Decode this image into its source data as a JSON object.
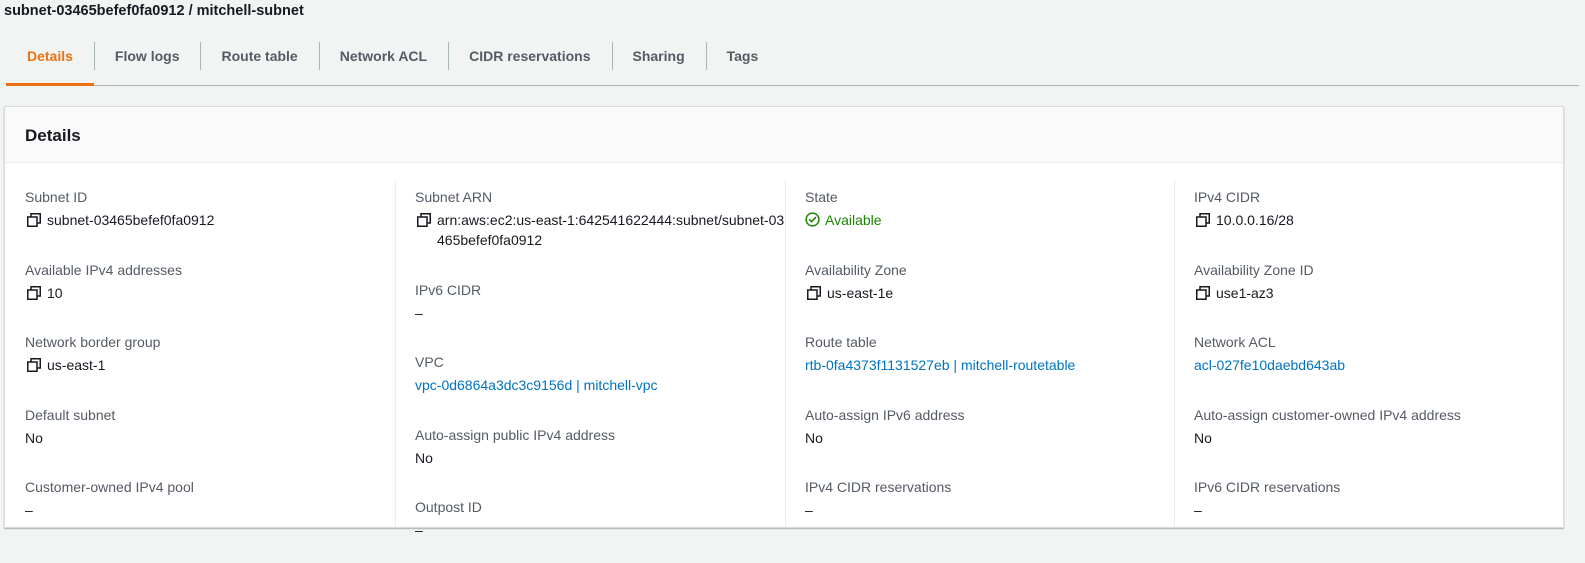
{
  "page": {
    "title": "subnet-03465befef0fa0912 / mitchell-subnet"
  },
  "tabs": [
    {
      "label": "Details",
      "active": true
    },
    {
      "label": "Flow logs",
      "active": false
    },
    {
      "label": "Route table",
      "active": false
    },
    {
      "label": "Network ACL",
      "active": false
    },
    {
      "label": "CIDR reservations",
      "active": false
    },
    {
      "label": "Sharing",
      "active": false
    },
    {
      "label": "Tags",
      "active": false
    }
  ],
  "details": {
    "heading": "Details",
    "col1": {
      "subnet_id": {
        "label": "Subnet ID",
        "value": "subnet-03465befef0fa0912"
      },
      "available_ipv4": {
        "label": "Available IPv4 addresses",
        "value": "10"
      },
      "network_border_group": {
        "label": "Network border group",
        "value": "us-east-1"
      },
      "default_subnet": {
        "label": "Default subnet",
        "value": "No"
      },
      "customer_owned_pool": {
        "label": "Customer-owned IPv4 pool",
        "value": "–"
      }
    },
    "col2": {
      "subnet_arn": {
        "label": "Subnet ARN",
        "value": "arn:aws:ec2:us-east-1:642541622444:subnet/subnet-03465befef0fa0912"
      },
      "ipv6_cidr": {
        "label": "IPv6 CIDR",
        "value": "–"
      },
      "vpc": {
        "label": "VPC",
        "value": "vpc-0d6864a3dc3c9156d | mitchell-vpc"
      },
      "auto_assign_public_ipv4": {
        "label": "Auto-assign public IPv4 address",
        "value": "No"
      },
      "outpost_id": {
        "label": "Outpost ID",
        "value": "–"
      }
    },
    "col3": {
      "state": {
        "label": "State",
        "value": "Available"
      },
      "availability_zone": {
        "label": "Availability Zone",
        "value": "us-east-1e"
      },
      "route_table": {
        "label": "Route table",
        "value": "rtb-0fa4373f1131527eb | mitchell-routetable"
      },
      "auto_assign_ipv6": {
        "label": "Auto-assign IPv6 address",
        "value": "No"
      },
      "ipv4_cidr_reservations": {
        "label": "IPv4 CIDR reservations",
        "value": "–"
      }
    },
    "col4": {
      "ipv4_cidr": {
        "label": "IPv4 CIDR",
        "value": "10.0.0.16/28"
      },
      "availability_zone_id": {
        "label": "Availability Zone ID",
        "value": "use1-az3"
      },
      "network_acl": {
        "label": "Network ACL",
        "value": "acl-027fe10daebd643ab"
      },
      "auto_assign_customer_ipv4": {
        "label": "Auto-assign customer-owned IPv4 address",
        "value": "No"
      },
      "ipv6_cidr_reservations": {
        "label": "IPv6 CIDR reservations",
        "value": "–"
      }
    }
  },
  "colors": {
    "accent": "#ec7211",
    "link": "#0073bb",
    "success": "#1d8102"
  },
  "icons": {
    "copy": "copy-icon",
    "status": "status-positive-icon"
  }
}
